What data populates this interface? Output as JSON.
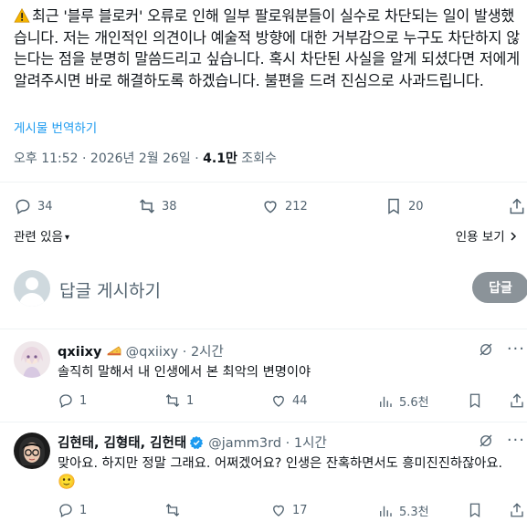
{
  "tweet": {
    "text_before_warning": "",
    "text": "최근 '블루 블로커' 오류로 인해 일부 팔로워분들이 실수로 차단되는 일이 발생했습니다. 저는 개인적인 의견이나 예술적 방향에 대한 거부감으로 누구도 차단하지 않는다는 점을 분명히 말씀드리고 싶습니다. 혹시 차단된 사실을 알게 되셨다면 저에게 알려주시면 바로 해결하도록 하겠습니다. 불편을 드려 진심으로 사과드립니다.",
    "translate": "게시물 번역하기",
    "time": "오후 11:52 · 2026년 2월 26일 · ",
    "views_count": "4.1만",
    "views_label": " 조회수",
    "replies": "34",
    "reposts": "38",
    "likes": "212",
    "bookmarks": "20"
  },
  "related": {
    "left": "관련 있음",
    "right": "인용 보기"
  },
  "composer": {
    "placeholder": "답글 게시하기",
    "button": "답글"
  },
  "replies": [
    {
      "name": "qxiixy",
      "handle": "@qxiixy · 2시간",
      "text": "솔직히 말해서 내 인생에서 본 최악의 변명이야",
      "replies": "1",
      "reposts": "1",
      "likes": "44",
      "views": "5.6천"
    },
    {
      "name": "김현태, 김형태, 김헌태",
      "handle": "@jamm3rd · 1시간",
      "text": "맞아요. 하지만 정말 그래요. 어쩌겠어요? 인생은 잔혹하면서도 흥미진진하잖아요.",
      "emoji": "🙂",
      "replies": "1",
      "reposts": "",
      "likes": "17",
      "views": "5.3천"
    }
  ],
  "colors": {
    "accent": "#1d9bf0",
    "muted": "#536471",
    "verified": "#1d9bf0",
    "reply_button": "#8b9399"
  }
}
